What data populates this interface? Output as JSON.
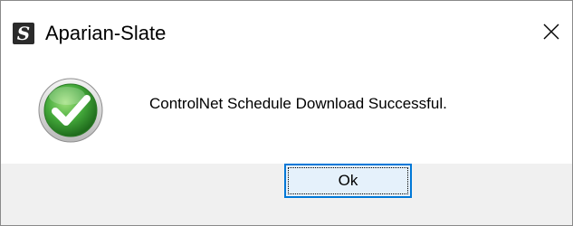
{
  "window": {
    "title": "Aparian-Slate",
    "app_icon_glyph": "S",
    "app_icon": "slate-app-icon",
    "close_icon": "close-icon"
  },
  "message": {
    "icon": "success-checkmark-icon",
    "text": "ControlNet Schedule Download Successful."
  },
  "buttons": {
    "ok_label": "Ok"
  },
  "colors": {
    "accent": "#0078d7",
    "button_bg": "#e5f1fb",
    "success_green": "#3fa83a",
    "footer_bg": "#f0f0f0"
  }
}
